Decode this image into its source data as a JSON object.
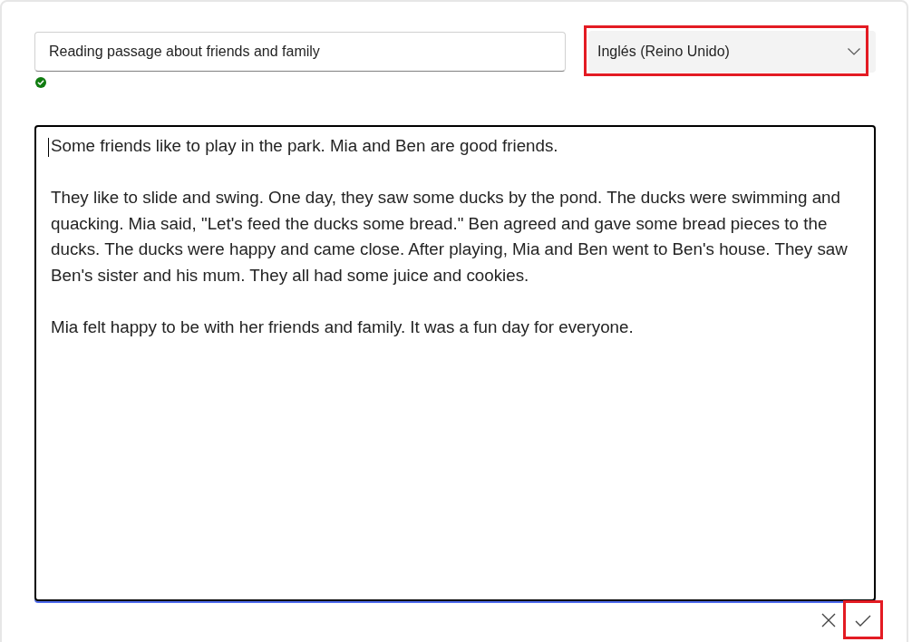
{
  "title_field": {
    "value": "Reading passage about friends and family",
    "valid": true
  },
  "language_dropdown": {
    "value": "Inglés (Reino Unido)",
    "highlighted": true
  },
  "text_area": {
    "focused": true,
    "paragraphs": [
      "Some friends like to play in the park. Mia and Ben are good friends.",
      "They like to slide and swing. One day, they saw some ducks by the pond. The ducks were swimming and quacking. Mia said, \"Let's feed the ducks some bread.\" Ben agreed and gave some bread pieces to the ducks. The ducks were happy and came close. After playing, Mia and Ben went to Ben's house. They saw Ben's sister and his mum. They all had some juice and cookies.",
      "Mia felt happy to be with her friends and family. It was a fun day for everyone."
    ]
  },
  "actions": [
    {
      "kind": "cancel",
      "highlighted": false
    },
    {
      "kind": "confirm",
      "highlighted": true
    }
  ]
}
